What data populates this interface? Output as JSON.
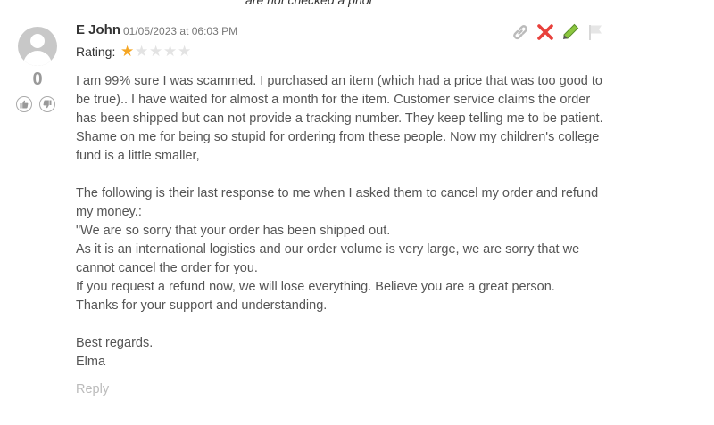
{
  "top_note": "are not checked a prior",
  "comment": {
    "author": "E John",
    "date": "01/05/2023 at 06:03 PM",
    "rating_label": "Rating:",
    "rating": 1,
    "rating_max": 5,
    "vote_count": "0",
    "icons": {
      "upvote": "thumbs-up-icon",
      "downvote": "thumbs-down-icon",
      "link": "link-icon",
      "delete": "close-icon",
      "edit": "pencil-icon",
      "report": "flag-icon"
    },
    "colors": {
      "star_filled": "#f5a623",
      "delete": "#e8403b",
      "edit": "#5cb85c"
    },
    "paragraphs": [
      "I am 99% sure I was scammed. I purchased an item (which had a price that was too good to be true).. I have waited for almost a month for the item. Customer service claims the order has been shipped but can not provide a tracking number. They keep telling me to be patient. Shame on me for being so stupid for ordering from these people. Now my children's college fund is a little smaller,",
      "",
      "The following is their last response to me when I asked them to cancel my order and refund my money.:",
      "\"We are so sorry that your order has been shipped out.",
      "As it is an international logistics and our order volume is very large, we are sorry that we cannot cancel the order for you.",
      "If you request a refund now, we will lose everything. Believe you are a great person.",
      "Thanks for your support and understanding.",
      "",
      "Best regards.",
      "Elma"
    ],
    "reply_label": "Reply"
  }
}
